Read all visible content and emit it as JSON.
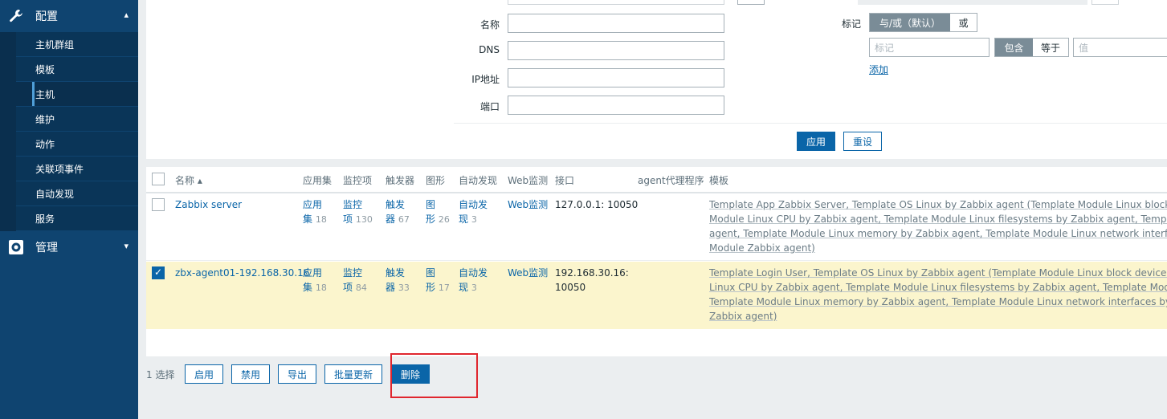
{
  "sidebar": {
    "config_label": "配置",
    "admin_label": "管理",
    "items": [
      {
        "label": "主机群组"
      },
      {
        "label": "模板"
      },
      {
        "label": "主机"
      },
      {
        "label": "维护"
      },
      {
        "label": "动作"
      },
      {
        "label": "关联项事件"
      },
      {
        "label": "自动发现"
      },
      {
        "label": "服务"
      }
    ],
    "selected": "主机"
  },
  "filter": {
    "name_label": "名称",
    "dns_label": "DNS",
    "ip_label": "IP地址",
    "port_label": "端口",
    "tags_label": "标记",
    "tag_mode_and_or": "与/或（默认）",
    "tag_mode_or": "或",
    "tag_placeholder": "标记",
    "op_contains": "包含",
    "op_equals": "等于",
    "value_placeholder": "值",
    "add_link": "添加",
    "apply_button": "应用",
    "reset_button": "重设"
  },
  "table": {
    "headers": {
      "name": "名称 ▴",
      "applications": "应用集",
      "items": "监控项",
      "triggers": "触发器",
      "graphs": "图形",
      "discovery": "自动发现",
      "web": "Web监测",
      "interface": "接口",
      "proxy": "agent代理程序",
      "templates": "模板"
    },
    "rows": [
      {
        "name": "Zabbix server",
        "app_a": "应用",
        "app_b": "集",
        "app_count": "18",
        "item_a": "监控",
        "item_b": "项",
        "item_count": "130",
        "trig_a": "触发",
        "trig_b": "器",
        "trig_count": "67",
        "graph_a": "图",
        "graph_b": "形",
        "graph_count": "26",
        "disc_a": "自动发",
        "disc_b": "现",
        "disc_count": "3",
        "web": "Web监测",
        "interface_l1": "127.0.0.1: 10050",
        "interface_l2": "",
        "tmpl_l1": "Template App Zabbix Server, Template OS Linux by Zabbix agent (Template Module Linux block devices by",
        "tmpl_l2": "Module Linux CPU by Zabbix agent, Template Module Linux filesystems by Zabbix agent, Template Module",
        "tmpl_l3": "agent, Template Module Linux memory by Zabbix agent, Template Module Linux network interfaces by Zab",
        "tmpl_l4": "Module Zabbix agent)"
      },
      {
        "name": "zbx-agent01-192.168.30.16",
        "app_a": "应用",
        "app_b": "集",
        "app_count": "18",
        "item_a": "监控",
        "item_b": "项",
        "item_count": "84",
        "trig_a": "触发",
        "trig_b": "器",
        "trig_count": "33",
        "graph_a": "图",
        "graph_b": "形",
        "graph_count": "17",
        "disc_a": "自动发",
        "disc_b": "现",
        "disc_count": "3",
        "web": "Web监测",
        "interface_l1": "192.168.30.16:",
        "interface_l2": "10050",
        "tmpl_l1": "Template Login User, Template OS Linux by Zabbix agent (Template Module Linux block devices by Zabbi",
        "tmpl_l2": "Linux CPU by Zabbix agent, Template Module Linux filesystems by Zabbix agent, Template Module Linux g",
        "tmpl_l3": "Template Module Linux memory by Zabbix agent, Template Module Linux network interfaces by Zabbix ag",
        "tmpl_l4": "Zabbix agent)"
      }
    ]
  },
  "actions": {
    "selected_count": "1 选择",
    "enable": "启用",
    "disable": "禁用",
    "export": "导出",
    "mass_update": "批量更新",
    "delete": "删除"
  },
  "colors": {
    "sidebar": "#0f4470",
    "accent": "#0a65a8",
    "selected_row": "#fbf5cd",
    "annotation": "#e0262e"
  }
}
